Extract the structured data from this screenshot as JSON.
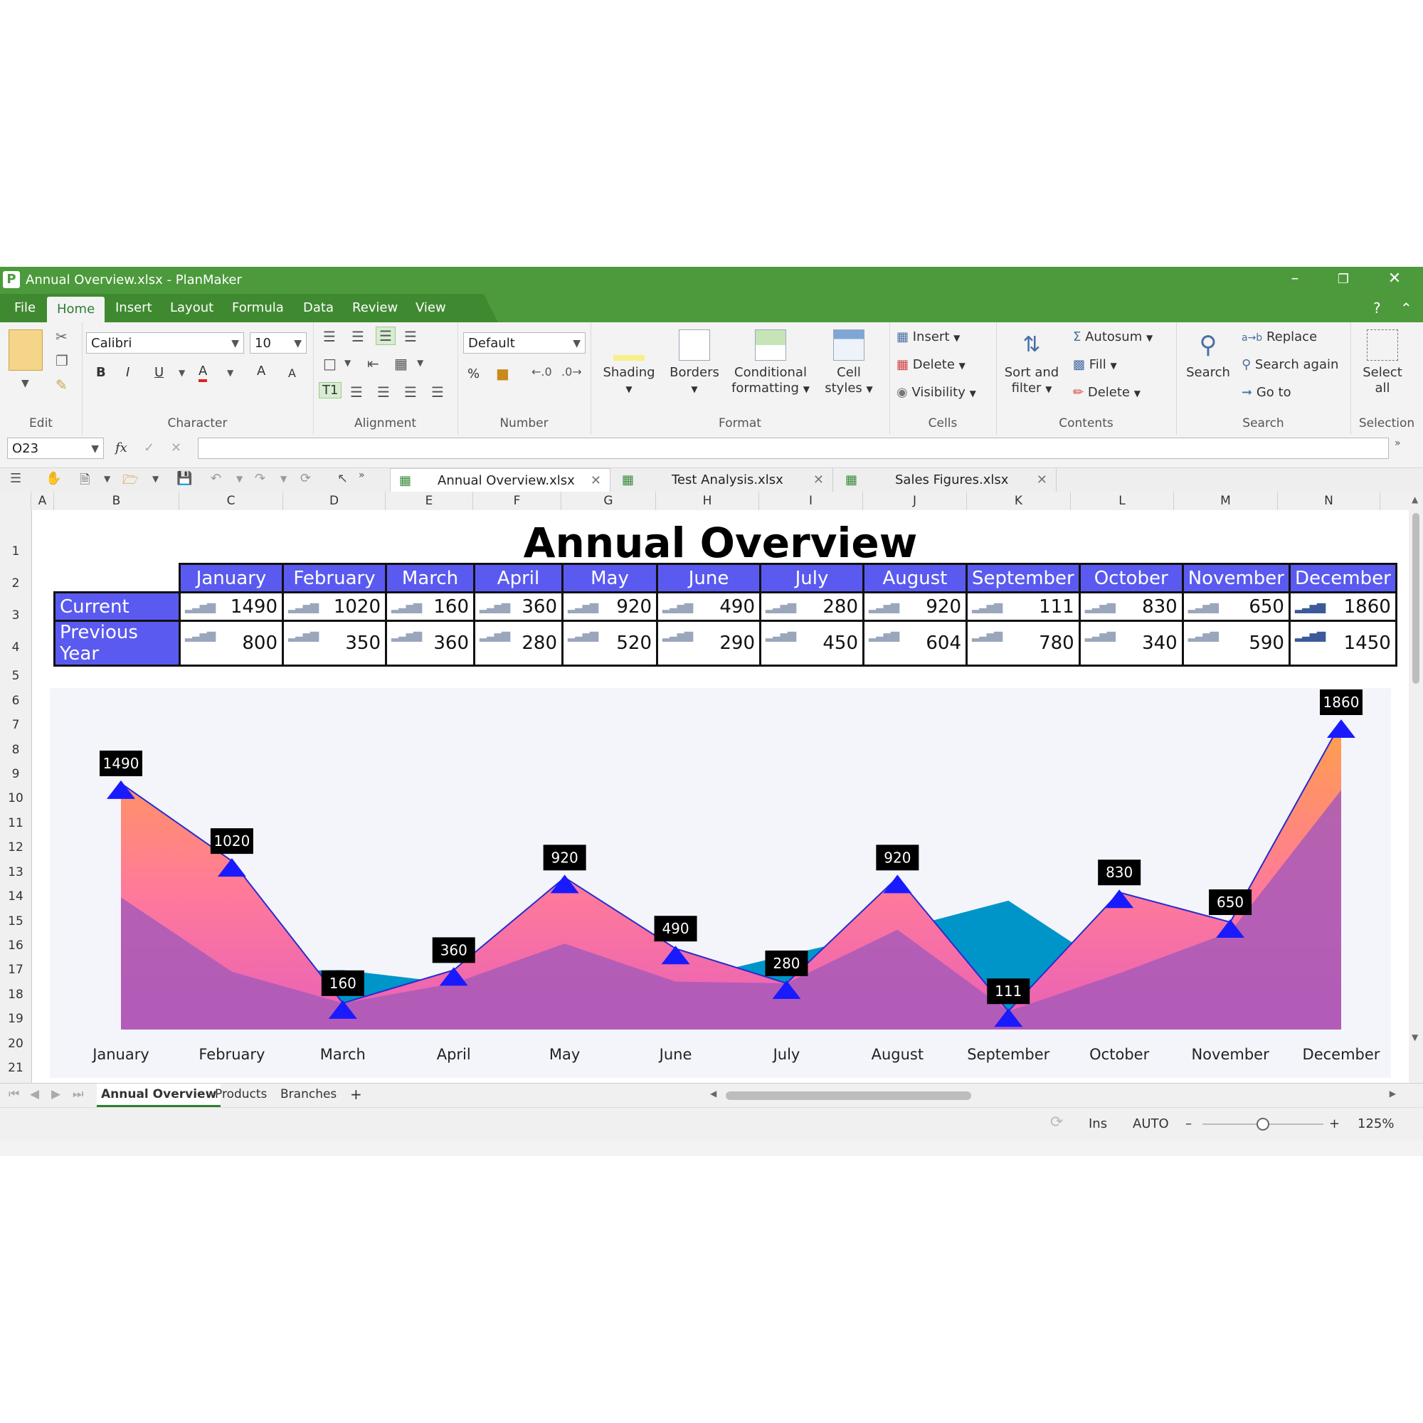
{
  "window": {
    "title": "Annual Overview.xlsx - PlanMaker",
    "app_icon": "P"
  },
  "menu": {
    "items": [
      "File",
      "Home",
      "Insert",
      "Layout",
      "Formula",
      "Data",
      "Review",
      "View"
    ],
    "active": "Home",
    "help": "?"
  },
  "ribbon": {
    "font_name": "Calibri",
    "font_size": "10",
    "number_format": "Default",
    "shading": "Shading",
    "borders": "Borders",
    "conditional_formatting_1": "Conditional",
    "conditional_formatting_2": "formatting",
    "cell_styles_1": "Cell",
    "cell_styles_2": "styles",
    "cells_insert": "Insert",
    "cells_delete": "Delete",
    "cells_visibility": "Visibility",
    "sort_filter_1": "Sort and",
    "sort_filter_2": "filter",
    "autosum": "Autosum",
    "fill": "Fill",
    "contents_delete": "Delete",
    "search": "Search",
    "replace": "Replace",
    "search_again": "Search again",
    "go_to": "Go to",
    "select_all_1": "Select",
    "select_all_2": "all",
    "groups": {
      "edit": "Edit",
      "character": "Character",
      "alignment": "Alignment",
      "number": "Number",
      "format": "Format",
      "cells": "Cells",
      "contents": "Contents",
      "search": "Search",
      "selection": "Selection"
    },
    "char_buttons": {
      "bold": "B",
      "italic": "I",
      "underline": "U",
      "font_color": "A",
      "grow": "A",
      "shrink": "A"
    },
    "percent": "%"
  },
  "formula_bar": {
    "cell_ref": "O23",
    "fx": "fx",
    "value": ""
  },
  "doc_tabs": [
    {
      "label": "Annual Overview.xlsx"
    },
    {
      "label": "Test Analysis.xlsx"
    },
    {
      "label": "Sales Figures.xlsx"
    }
  ],
  "columns": [
    "A",
    "B",
    "C",
    "D",
    "E",
    "F",
    "G",
    "H",
    "I",
    "J",
    "K",
    "L",
    "M",
    "N"
  ],
  "rows": [
    "1",
    "2",
    "3",
    "4",
    "5",
    "6",
    "7",
    "8",
    "9",
    "10",
    "11",
    "12",
    "13",
    "14",
    "15",
    "16",
    "17",
    "18",
    "19",
    "20",
    "21"
  ],
  "sheet": {
    "title": "Annual Overview",
    "table": {
      "months": [
        "January",
        "February",
        "March",
        "April",
        "May",
        "June",
        "July",
        "August",
        "September",
        "October",
        "November",
        "December"
      ],
      "rows": [
        {
          "label": "Current",
          "values": [
            "1490",
            "1020",
            "160",
            "360",
            "920",
            "490",
            "280",
            "920",
            "111",
            "830",
            "650",
            "1860"
          ]
        },
        {
          "label": "Previous Year",
          "values": [
            "800",
            "350",
            "360",
            "280",
            "520",
            "290",
            "450",
            "604",
            "780",
            "340",
            "590",
            "1450"
          ]
        }
      ]
    }
  },
  "chart_data": {
    "type": "area",
    "categories": [
      "January",
      "February",
      "March",
      "April",
      "May",
      "June",
      "July",
      "August",
      "September",
      "October",
      "November",
      "December"
    ],
    "series": [
      {
        "values": [
          1490,
          1020,
          160,
          360,
          920,
          490,
          280,
          920,
          111,
          830,
          650,
          1860
        ],
        "color": "#ff9966"
      },
      {
        "values": [
          800,
          350,
          360,
          280,
          520,
          290,
          450,
          604,
          780,
          340,
          590,
          1450
        ],
        "color": "#0095c8"
      }
    ],
    "ylim": [
      0,
      1860
    ],
    "data_labels": true,
    "grid": false,
    "legend": "none"
  },
  "sheet_tabs": [
    "Annual Overview",
    "Products",
    "Branches"
  ],
  "sheet_tab_active": "Annual Overview",
  "sheet_tab_add": "+",
  "status": {
    "mode": "Ins",
    "calc": "AUTO",
    "zoom": "125%",
    "zoom_level": 0.5
  },
  "colors": {
    "title_bar": "#4c9a3c",
    "table_header": "#5a5af0",
    "marker": "#1a1aff",
    "line": "#2a2ad0",
    "label_bg": "#000000"
  }
}
